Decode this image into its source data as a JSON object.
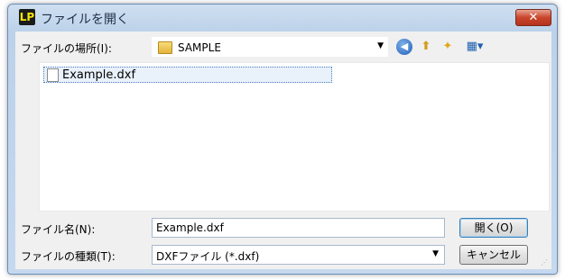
{
  "window": {
    "title": "ファイルを開く",
    "app_icon_text": "LP",
    "close_label": "✕"
  },
  "location": {
    "label": "ファイルの場所(I):",
    "value": "SAMPLE"
  },
  "toolbar": {
    "back_glyph": "◀",
    "up_glyph": "⬆",
    "new_folder_glyph": "✦",
    "view_glyph": "▦▾"
  },
  "files": [
    {
      "name": "Example.dxf"
    }
  ],
  "filename": {
    "label": "ファイル名(N):",
    "value": "Example.dxf"
  },
  "filetype": {
    "label": "ファイルの種類(T):",
    "value": "DXFファイル (*.dxf)"
  },
  "buttons": {
    "open": "開く(O)",
    "cancel": "キャンセル"
  },
  "colors": {
    "title_bar": "#c5d8ee",
    "close_button": "#c9452c",
    "selection_border": "#4a7dc0"
  }
}
